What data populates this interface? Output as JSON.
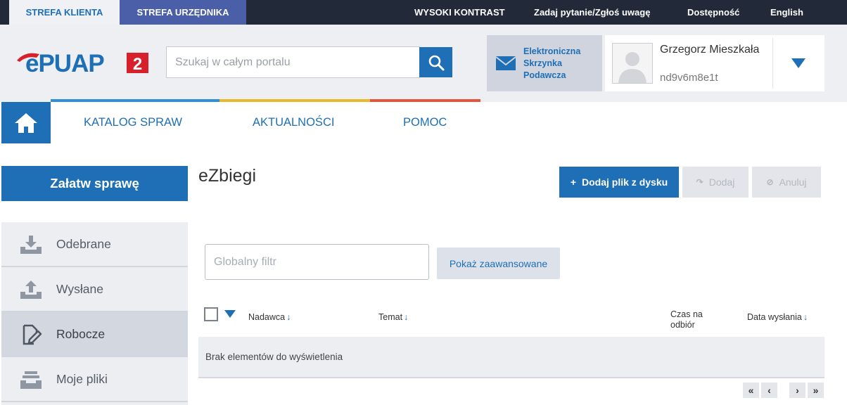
{
  "topbar": {
    "client_zone": "STREFA KLIENTA",
    "official_zone": "STREFA URZĘDNIKA",
    "high_contrast": "WYSOKI KONTRAST",
    "ask_question": "Zadaj pytanie/Zgłoś uwagę",
    "accessibility": "Dostępność",
    "english": "English"
  },
  "header": {
    "logo_text": "ePUAP",
    "logo_badge": "2",
    "search_placeholder": "Szukaj w całym portalu",
    "esp_label": "Elektroniczna Skrzynka Podawcza",
    "user_name": "Grzegorz Mieszkała",
    "user_id": "nd9v6m8e1t"
  },
  "nav": {
    "items": [
      "KATALOG SPRAW",
      "AKTUALNOŚCI",
      "POMOC"
    ]
  },
  "sidebar": {
    "cta": "Załatw sprawę",
    "items": [
      {
        "label": "Odebrane",
        "icon": "inbox-download-icon"
      },
      {
        "label": "Wysłane",
        "icon": "outbox-upload-icon"
      },
      {
        "label": "Robocze",
        "icon": "edit-document-icon"
      },
      {
        "label": "Moje pliki",
        "icon": "file-tray-icon"
      }
    ]
  },
  "main": {
    "title": "eZbiegi",
    "add_file_button": "Dodaj plik z dysku",
    "add_button": "Dodaj",
    "cancel_button": "Anuluj",
    "filter_placeholder": "Globalny filtr",
    "advanced_button": "Pokaż zaawansowane",
    "columns": {
      "sender": "Nadawca",
      "subject": "Temat",
      "pickup_time": "Czas na odbiór",
      "sent_date": "Data wysłania"
    },
    "empty_message": "Brak elementów do wyświetlenia",
    "pagination": {
      "first": "«",
      "prev": "‹",
      "next": "›",
      "last": "»"
    }
  },
  "colors": {
    "accent": "#1e6fb5",
    "topbar": "#222a3a",
    "official_tab": "#4b5ea8",
    "line_blue": "#2f8fd8",
    "line_yellow": "#e8b92b",
    "line_red": "#e5533d",
    "logo_red": "#d7202b"
  }
}
